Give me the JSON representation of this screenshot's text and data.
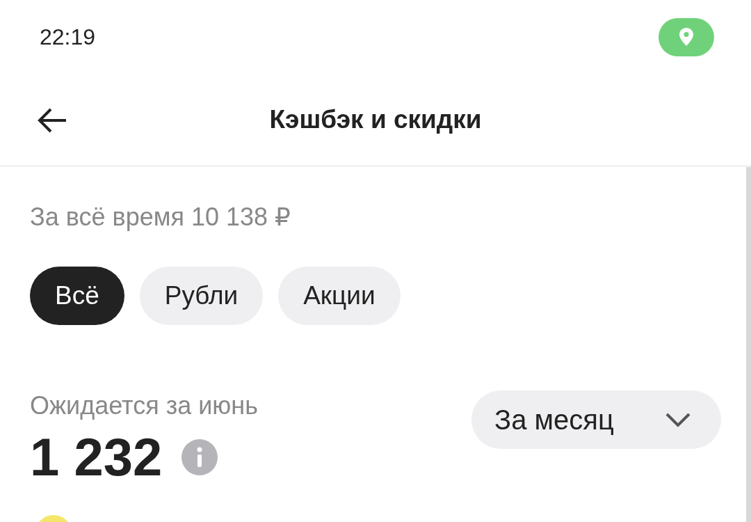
{
  "status_bar": {
    "time": "22:19",
    "location_active": true
  },
  "header": {
    "title": "Кэшбэк и скидки"
  },
  "total": "За всё время 10 138 ₽",
  "filters": [
    {
      "label": "Всё",
      "selected": true
    },
    {
      "label": "Рубли",
      "selected": false
    },
    {
      "label": "Акции",
      "selected": false
    }
  ],
  "expected": {
    "label": "Ожидается за июнь",
    "amount": "1 232"
  },
  "period_dropdown": {
    "value": "За месяц"
  }
}
